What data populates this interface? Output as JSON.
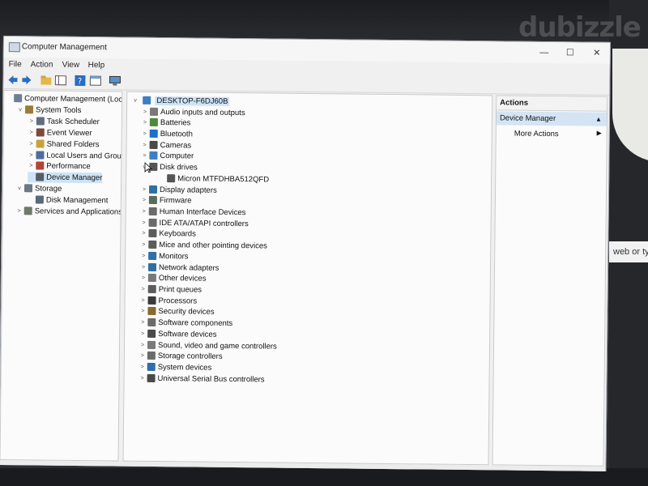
{
  "window": {
    "title": "Computer Management",
    "controls": {
      "minimize": "—",
      "maximize": "☐",
      "close": "✕"
    }
  },
  "menu": [
    "File",
    "Action",
    "View",
    "Help"
  ],
  "toolbar": [
    "back-arrow-icon",
    "forward-arrow-icon",
    "up-folder-icon",
    "console-tree-icon",
    "help-icon",
    "properties-icon",
    "monitor-icon"
  ],
  "left_tree": [
    {
      "label": "Computer Management (Local)",
      "level": 0,
      "expander": "",
      "icon": "computer-management-icon",
      "color": "#6e7f95",
      "selected": false
    },
    {
      "label": "System Tools",
      "level": 1,
      "expander": "v",
      "icon": "system-tools-icon",
      "color": "#9a7b3c",
      "selected": false
    },
    {
      "label": "Task Scheduler",
      "level": 2,
      "expander": ">",
      "icon": "clock-icon",
      "color": "#5f6f80",
      "selected": false
    },
    {
      "label": "Event Viewer",
      "level": 2,
      "expander": ">",
      "icon": "event-viewer-icon",
      "color": "#7c4a3a",
      "selected": false
    },
    {
      "label": "Shared Folders",
      "level": 2,
      "expander": ">",
      "icon": "shared-folder-icon",
      "color": "#c9a23a",
      "selected": false
    },
    {
      "label": "Local Users and Groups",
      "level": 2,
      "expander": ">",
      "icon": "users-icon",
      "color": "#4d6e9c",
      "selected": false
    },
    {
      "label": "Performance",
      "level": 2,
      "expander": ">",
      "icon": "performance-icon",
      "color": "#b0433a",
      "selected": false
    },
    {
      "label": "Device Manager",
      "level": 2,
      "expander": "",
      "icon": "device-manager-icon",
      "color": "#555d66",
      "selected": true
    },
    {
      "label": "Storage",
      "level": 1,
      "expander": "v",
      "icon": "storage-icon",
      "color": "#6b7886",
      "selected": false
    },
    {
      "label": "Disk Management",
      "level": 2,
      "expander": "",
      "icon": "disk-icon",
      "color": "#5a6a7a",
      "selected": false
    },
    {
      "label": "Services and Applications",
      "level": 1,
      "expander": ">",
      "icon": "services-icon",
      "color": "#6f7a6a",
      "selected": false
    }
  ],
  "device_tree": {
    "root": {
      "label": "DESKTOP-F6DJ60B",
      "expander": "v",
      "icon": "computer-icon",
      "color": "#3d7fc1"
    },
    "categories": [
      {
        "label": "Audio inputs and outputs",
        "expander": ">",
        "icon": "speaker-icon",
        "color": "#7a7a7a",
        "level": 1
      },
      {
        "label": "Batteries",
        "expander": ">",
        "icon": "battery-icon",
        "color": "#4f8a3c",
        "level": 1
      },
      {
        "label": "Bluetooth",
        "expander": ">",
        "icon": "bluetooth-icon",
        "color": "#1e6fc9",
        "level": 1
      },
      {
        "label": "Cameras",
        "expander": ">",
        "icon": "camera-icon",
        "color": "#4a4a4a",
        "level": 1
      },
      {
        "label": "Computer",
        "expander": ">",
        "icon": "computer-icon",
        "color": "#3d7fc1",
        "level": 1
      },
      {
        "label": "Disk drives",
        "expander": "v",
        "icon": "disk-drive-icon",
        "color": "#555555",
        "level": 1
      },
      {
        "label": "Micron MTFDHBA512QFD",
        "expander": "",
        "icon": "disk-drive-icon",
        "color": "#555555",
        "level": 2
      },
      {
        "label": "Display adapters",
        "expander": ">",
        "icon": "display-adapter-icon",
        "color": "#2f6fa8",
        "level": 1
      },
      {
        "label": "Firmware",
        "expander": ">",
        "icon": "firmware-icon",
        "color": "#5a6b5a",
        "level": 1
      },
      {
        "label": "Human Interface Devices",
        "expander": ">",
        "icon": "hid-icon",
        "color": "#6b6b6b",
        "level": 1
      },
      {
        "label": "IDE ATA/ATAPI controllers",
        "expander": ">",
        "icon": "ide-controller-icon",
        "color": "#6b6b6b",
        "level": 1
      },
      {
        "label": "Keyboards",
        "expander": ">",
        "icon": "keyboard-icon",
        "color": "#5c5c5c",
        "level": 1
      },
      {
        "label": "Mice and other pointing devices",
        "expander": ">",
        "icon": "mouse-icon",
        "color": "#5c5c5c",
        "level": 1
      },
      {
        "label": "Monitors",
        "expander": ">",
        "icon": "monitor-icon",
        "color": "#2f6fa8",
        "level": 1
      },
      {
        "label": "Network adapters",
        "expander": ">",
        "icon": "network-adapter-icon",
        "color": "#2f6fa8",
        "level": 1
      },
      {
        "label": "Other devices",
        "expander": ">",
        "icon": "other-devices-icon",
        "color": "#7a7a7a",
        "level": 1
      },
      {
        "label": "Print queues",
        "expander": ">",
        "icon": "printer-icon",
        "color": "#5c5c5c",
        "level": 1
      },
      {
        "label": "Processors",
        "expander": ">",
        "icon": "processor-icon",
        "color": "#3a3a3a",
        "level": 1
      },
      {
        "label": "Security devices",
        "expander": ">",
        "icon": "security-icon",
        "color": "#8a6a2a",
        "level": 1
      },
      {
        "label": "Software components",
        "expander": ">",
        "icon": "software-component-icon",
        "color": "#6b6b6b",
        "level": 1
      },
      {
        "label": "Software devices",
        "expander": ">",
        "icon": "software-device-icon",
        "color": "#4a4a4a",
        "level": 1
      },
      {
        "label": "Sound, video and game controllers",
        "expander": ">",
        "icon": "sound-icon",
        "color": "#7a7a7a",
        "level": 1
      },
      {
        "label": "Storage controllers",
        "expander": ">",
        "icon": "storage-controller-icon",
        "color": "#6b6b6b",
        "level": 1
      },
      {
        "label": "System devices",
        "expander": ">",
        "icon": "system-devices-icon",
        "color": "#2f6fa8",
        "level": 1
      },
      {
        "label": "Universal Serial Bus controllers",
        "expander": ">",
        "icon": "usb-icon",
        "color": "#4a4a4a",
        "level": 1
      }
    ]
  },
  "actions": {
    "header": "Actions",
    "section": "Device Manager",
    "section_caret": "▲",
    "items": [
      {
        "label": "More Actions",
        "arrow": "▶"
      }
    ]
  },
  "background": {
    "watermark": "dubizzle",
    "side_text": "web or typ"
  }
}
